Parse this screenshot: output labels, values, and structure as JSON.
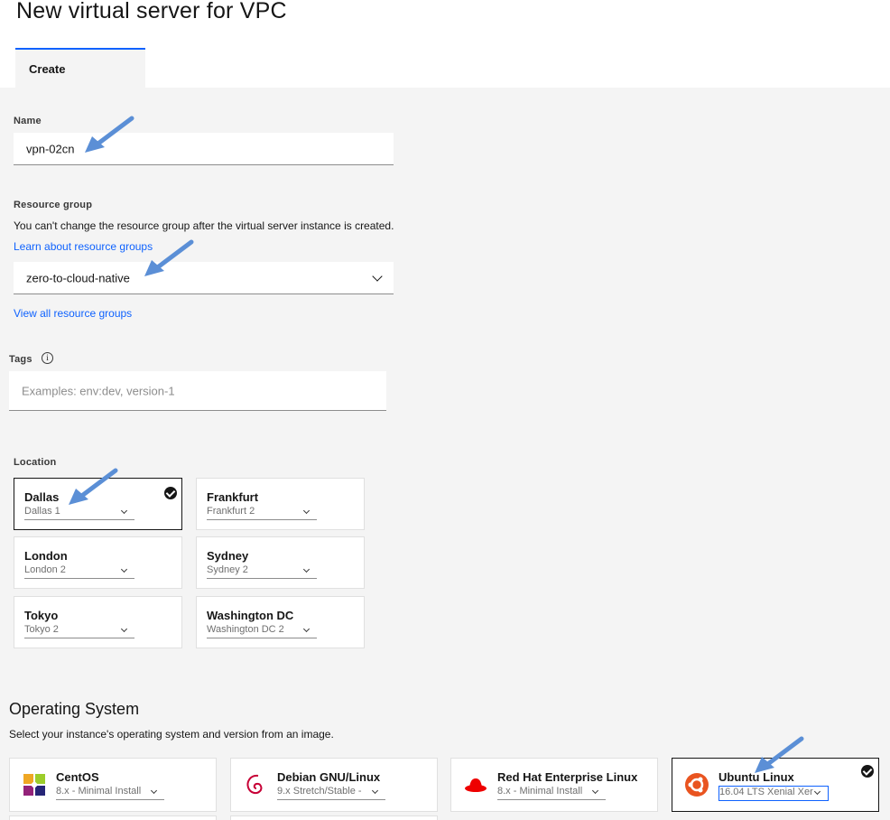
{
  "page": {
    "title": "New virtual server for VPC"
  },
  "tabs": [
    {
      "label": "Create"
    }
  ],
  "name_field": {
    "label": "Name",
    "value": "vpn-02cn"
  },
  "resource_group": {
    "label": "Resource group",
    "description": "You can't change the resource group after the virtual server instance is created.",
    "learn_link": "Learn about resource groups",
    "value": "zero-to-cloud-native",
    "view_all_link": "View all resource groups"
  },
  "tags": {
    "label": "Tags",
    "info_icon": "i",
    "placeholder": "Examples: env:dev, version-1"
  },
  "location": {
    "label": "Location",
    "tiles": [
      {
        "city": "Dallas",
        "zone": "Dallas 1",
        "selected": true
      },
      {
        "city": "Frankfurt",
        "zone": "Frankfurt 2",
        "selected": false
      },
      {
        "city": "London",
        "zone": "London 2",
        "selected": false
      },
      {
        "city": "Sydney",
        "zone": "Sydney 2",
        "selected": false
      },
      {
        "city": "Tokyo",
        "zone": "Tokyo 2",
        "selected": false
      },
      {
        "city": "Washington DC",
        "zone": "Washington DC 2",
        "selected": false
      }
    ]
  },
  "os": {
    "title": "Operating System",
    "description": "Select your instance's operating system and version from an image.",
    "images": [
      {
        "name": "CentOS",
        "version": "8.x - Minimal Install",
        "icon": "centos-icon",
        "selected": false
      },
      {
        "name": "Debian GNU/Linux",
        "version": "9.x Stretch/Stable -",
        "icon": "debian-icon",
        "selected": false
      },
      {
        "name": "Red Hat Enterprise Linux",
        "version": "8.x - Minimal Install",
        "icon": "redhat-icon",
        "selected": false
      },
      {
        "name": "Ubuntu Linux",
        "version": "16.04 LTS Xenial Xer",
        "icon": "ubuntu-icon",
        "selected": true
      }
    ]
  },
  "colors": {
    "accent": "#0f62fe",
    "annotation_arrow": "#5b8fd6"
  }
}
